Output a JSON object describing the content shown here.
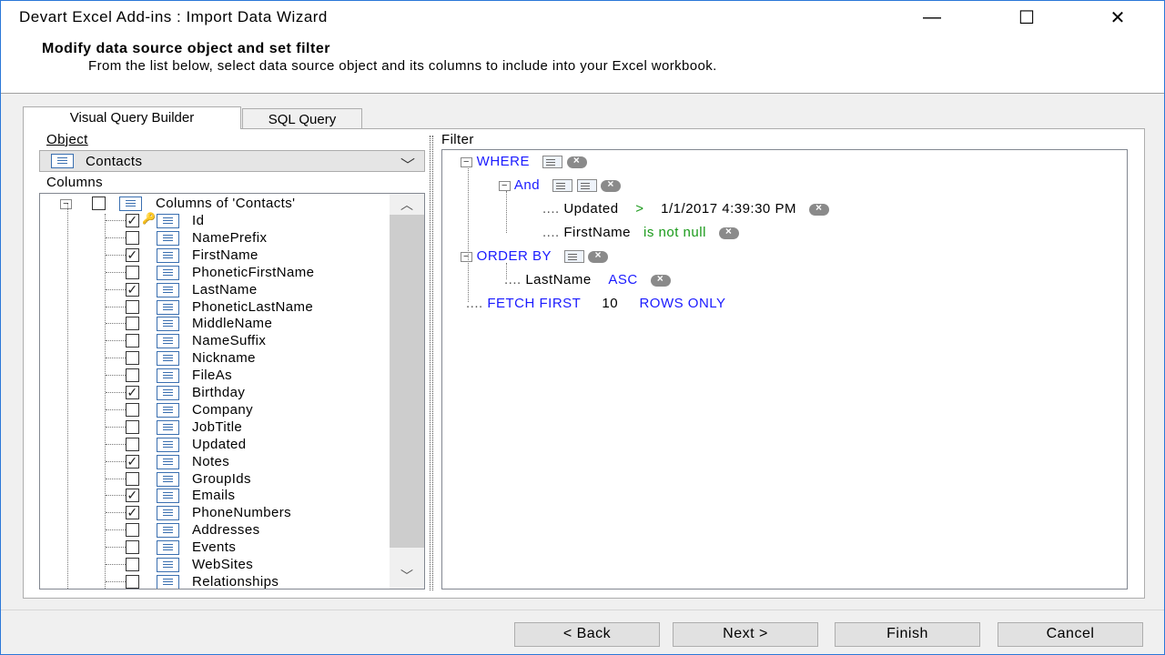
{
  "window": {
    "title": "Devart Excel Add-ins : Import Data Wizard",
    "minimize": "—",
    "maximize": "☐",
    "close": "✕"
  },
  "header": {
    "title": "Modify data source object and set filter",
    "description": "From the list below, select data source object and its columns to include into your Excel workbook."
  },
  "tabs": [
    {
      "label": "Visual Query Builder",
      "active": true
    },
    {
      "label": "SQL Query",
      "active": false
    }
  ],
  "object": {
    "label": "Object",
    "selected": "Contacts"
  },
  "columns": {
    "label": "Columns",
    "root_label": "Columns of 'Contacts'",
    "items": [
      {
        "name": "Id",
        "checked": true,
        "key": true
      },
      {
        "name": "NamePrefix",
        "checked": false
      },
      {
        "name": "FirstName",
        "checked": true
      },
      {
        "name": "PhoneticFirstName",
        "checked": false
      },
      {
        "name": "LastName",
        "checked": true
      },
      {
        "name": "PhoneticLastName",
        "checked": false
      },
      {
        "name": "MiddleName",
        "checked": false
      },
      {
        "name": "NameSuffix",
        "checked": false
      },
      {
        "name": "Nickname",
        "checked": false
      },
      {
        "name": "FileAs",
        "checked": false
      },
      {
        "name": "Birthday",
        "checked": true
      },
      {
        "name": "Company",
        "checked": false
      },
      {
        "name": "JobTitle",
        "checked": false
      },
      {
        "name": "Updated",
        "checked": false
      },
      {
        "name": "Notes",
        "checked": true
      },
      {
        "name": "GroupIds",
        "checked": false
      },
      {
        "name": "Emails",
        "checked": true
      },
      {
        "name": "PhoneNumbers",
        "checked": true
      },
      {
        "name": "Addresses",
        "checked": false
      },
      {
        "name": "Events",
        "checked": false
      },
      {
        "name": "WebSites",
        "checked": false
      },
      {
        "name": "Relationships",
        "checked": false
      }
    ]
  },
  "filter": {
    "label": "Filter",
    "where": "WHERE",
    "and": "And",
    "cond1": {
      "field": "Updated",
      "op": ">",
      "value": "1/1/2017 4:39:30 PM"
    },
    "cond2": {
      "field": "FirstName",
      "op": "is not null"
    },
    "order_by": "ORDER BY",
    "order": {
      "field": "LastName",
      "dir": "ASC"
    },
    "fetch_first": "FETCH FIRST",
    "fetch_count": "10",
    "rows_only": "ROWS ONLY"
  },
  "buttons": {
    "back": "< Back",
    "next": "Next >",
    "finish": "Finish",
    "cancel": "Cancel"
  },
  "colors": {
    "keyword": "#1a1aff",
    "operator": "#1a9a1a",
    "title_border": "#2b78d8"
  }
}
